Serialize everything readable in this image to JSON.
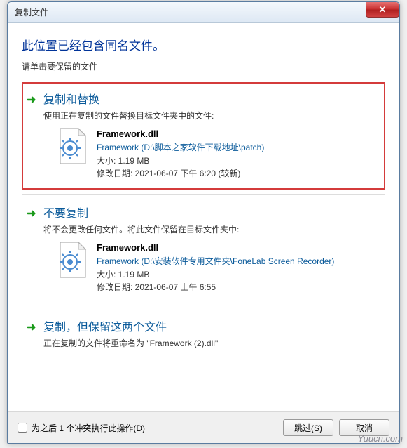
{
  "titlebar": {
    "title": "复制文件",
    "close_label": "✕"
  },
  "heading": "此位置已经包含同名文件。",
  "subheading": "请单击要保留的文件",
  "option1": {
    "title": "复制和替换",
    "desc": "使用正在复制的文件替换目标文件夹中的文件:",
    "file": {
      "name": "Framework.dll",
      "path": "Framework (D:\\脚本之家软件下载地址\\patch)",
      "size_label": "大小: 1.19 MB",
      "date_label": "修改日期: 2021-06-07 下午 6:20 (较新)"
    }
  },
  "option2": {
    "title": "不要复制",
    "desc": "将不会更改任何文件。将此文件保留在目标文件夹中:",
    "file": {
      "name": "Framework.dll",
      "path": "Framework (D:\\安装软件专用文件夹\\FoneLab Screen Recorder)",
      "size_label": "大小: 1.19 MB",
      "date_label": "修改日期: 2021-06-07 上午 6:55"
    }
  },
  "option3": {
    "title": "复制，但保留这两个文件",
    "desc": "正在复制的文件将重命名为 \"Framework (2).dll\""
  },
  "footer": {
    "checkbox_label": "为之后 1 个冲突执行此操作(D)",
    "skip_label": "跳过(S)",
    "cancel_label": "取消"
  },
  "watermark": "Yuucn.com"
}
